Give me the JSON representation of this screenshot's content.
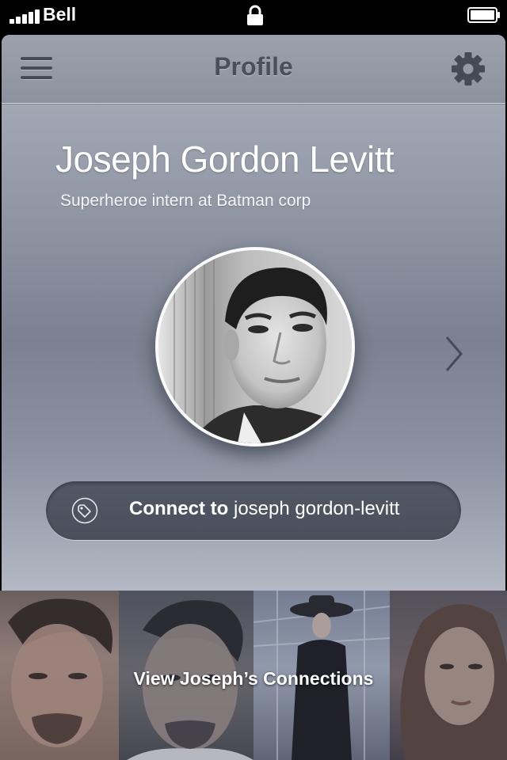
{
  "status_bar": {
    "carrier": "Bell",
    "signal_bars": 5,
    "battery_level": 1.0,
    "icons": [
      "signal-icon",
      "lock-icon",
      "battery-icon"
    ]
  },
  "nav": {
    "title": "Profile",
    "menu_icon": "hamburger-menu-icon",
    "settings_icon": "gear-icon"
  },
  "profile": {
    "name": "Joseph Gordon Levitt",
    "subtitle": "Superheroe intern at Batman corp",
    "avatar": "profile-photo",
    "next_icon": "chevron-right-icon"
  },
  "connect": {
    "icon": "tag-icon",
    "label_bold": "Connect to",
    "label_rest": " joseph gordon-levitt"
  },
  "connections": {
    "label": "View Joseph’s Connections",
    "photos": [
      "connection-photo-1",
      "connection-photo-2",
      "connection-photo-3",
      "connection-photo-4"
    ]
  },
  "colors": {
    "card_top": "#aeb3bf",
    "card_mid": "#7b8190",
    "button_bg": "#4f5461",
    "nav_icon": "#454a56",
    "text_light": "#ffffff"
  }
}
